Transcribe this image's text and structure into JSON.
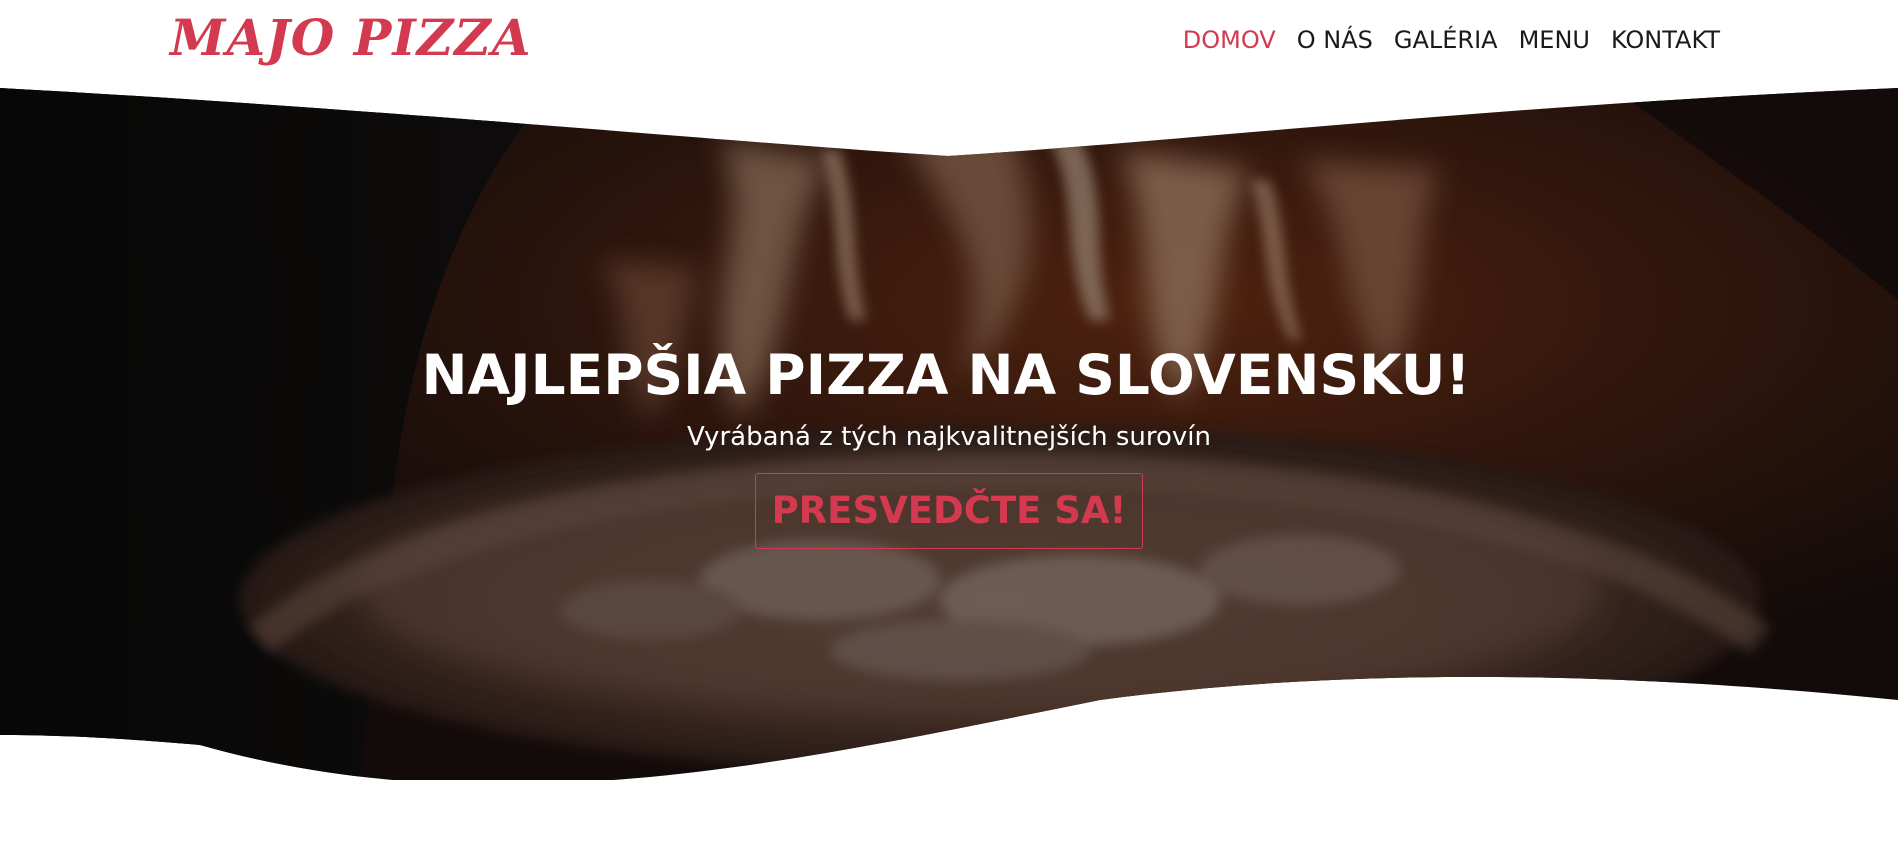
{
  "brand": {
    "logo_text": "MAJO PIZZA",
    "accent_color": "#d33a4f"
  },
  "nav": {
    "items": [
      {
        "label": "DOMOV",
        "active": true
      },
      {
        "label": "O NÁS",
        "active": false
      },
      {
        "label": "GALÉRIA",
        "active": false
      },
      {
        "label": "MENU",
        "active": false
      },
      {
        "label": "KONTAKT",
        "active": false
      }
    ]
  },
  "hero": {
    "title": "NAJLEPŠIA PIZZA NA SLOVENSKU!",
    "subtitle": "Vyrábaná z tých najkvalitnejších surovín",
    "cta_label": "PRESVEDČTE SA!",
    "background_image": "pizza-in-wood-fired-oven"
  }
}
